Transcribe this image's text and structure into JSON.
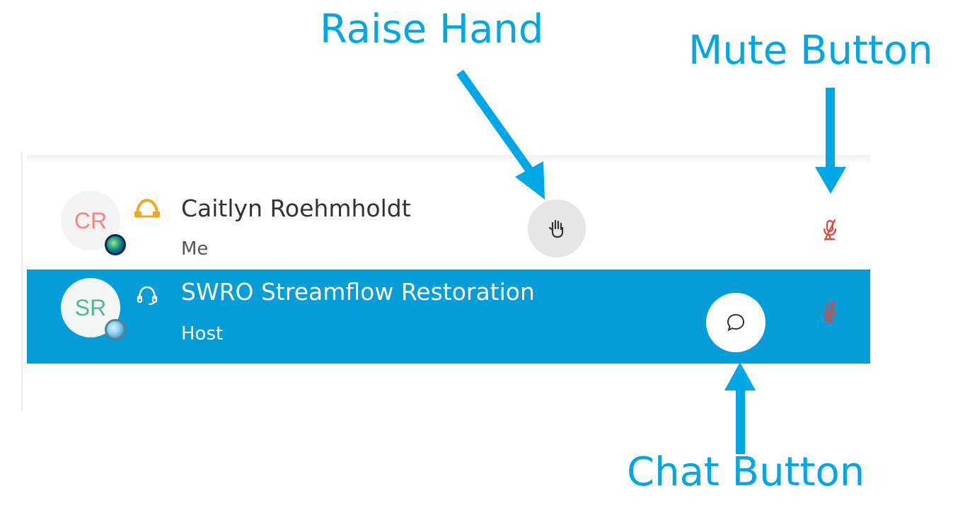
{
  "annotations": {
    "raise_hand": "Raise Hand",
    "mute_button": "Mute Button",
    "chat_button": "Chat Button"
  },
  "colors": {
    "annotation": "#00a7e6",
    "selected_row": "#049dd8",
    "muted_mic": "#e8433a",
    "audio_active": "#f5a623"
  },
  "participants": [
    {
      "initials": "CR",
      "name": "Caitlyn Roehmholdt",
      "role": "Me",
      "audio_icon": "headset-icon",
      "action_icon": "raise-hand-icon",
      "mute_icon": "muted-mic-icon",
      "selected": false
    },
    {
      "initials": "SR",
      "name": "SWRO Streamflow Restoration",
      "role": "Host",
      "audio_icon": "headset-icon",
      "action_icon": "chat-bubble-icon",
      "mute_icon": "muted-mic-icon",
      "selected": true
    }
  ]
}
